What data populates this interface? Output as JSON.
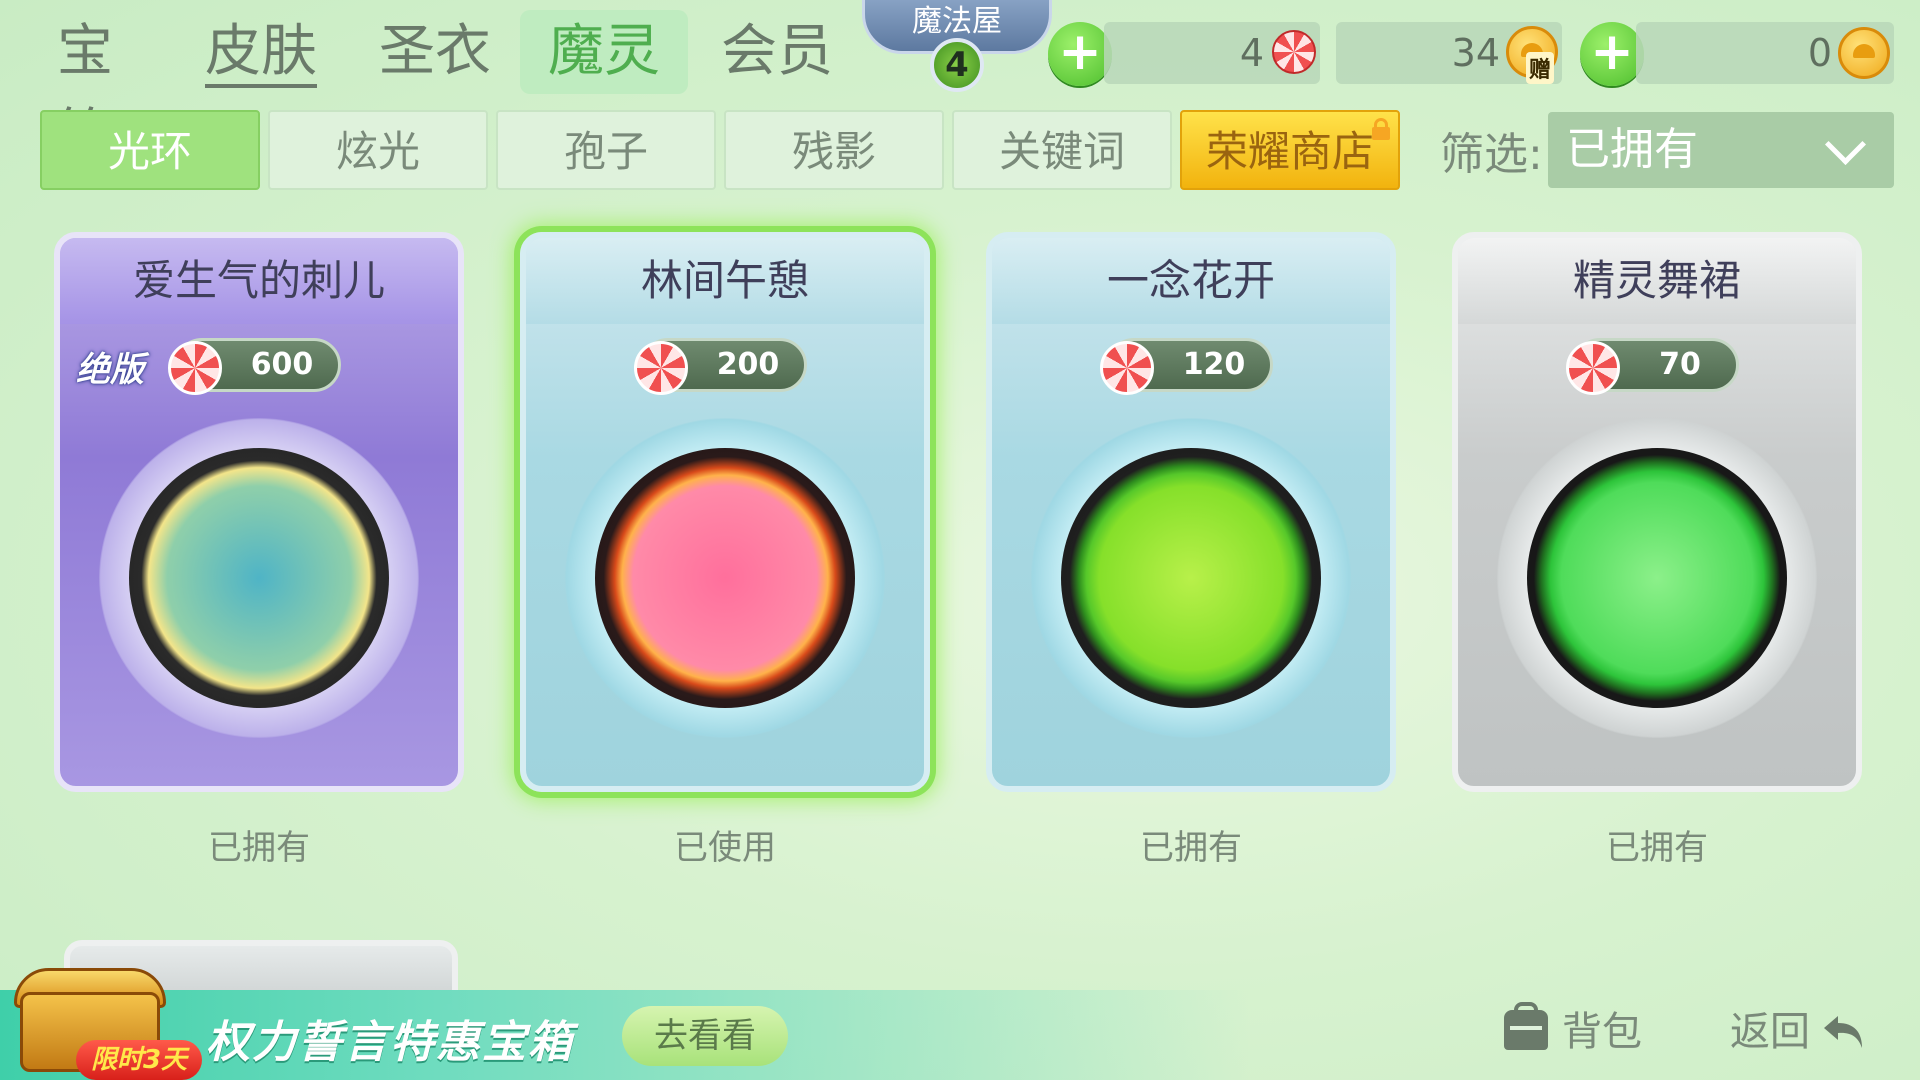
{
  "top_tabs": [
    {
      "label": "宝箱"
    },
    {
      "label": "皮肤"
    },
    {
      "label": "圣衣"
    },
    {
      "label": "魔灵"
    },
    {
      "label": "会员"
    }
  ],
  "magic_house": {
    "label": "魔法屋",
    "level": "4"
  },
  "resources": {
    "lollipop_count": "4",
    "gift_coin_count": "34",
    "gift_tag": "赠",
    "coin_count": "0"
  },
  "sub_tabs": [
    {
      "label": "光环"
    },
    {
      "label": "炫光"
    },
    {
      "label": "孢子"
    },
    {
      "label": "残影"
    },
    {
      "label": "关键词"
    },
    {
      "label": "荣耀商店"
    }
  ],
  "filter": {
    "label": "筛选:",
    "value": "已拥有"
  },
  "cards": [
    {
      "title": "爱生气的刺儿",
      "price": "600",
      "badge": "绝版",
      "status": "已拥有"
    },
    {
      "title": "林间午憩",
      "price": "200",
      "status": "已使用"
    },
    {
      "title": "一念花开",
      "price": "120",
      "status": "已拥有"
    },
    {
      "title": "精灵舞裙",
      "price": "70",
      "status": "已拥有"
    }
  ],
  "colors": {
    "accent_green": "#9fe27e",
    "honor_gold": "#f2b30e",
    "selected_glow": "#8de35a",
    "background": "#d7f2cf"
  },
  "banner": {
    "text": "权力誓言特惠宝箱",
    "button": "去看看",
    "limit_tag": "限时3天"
  },
  "footer": {
    "bag": "背包",
    "back": "返回"
  }
}
